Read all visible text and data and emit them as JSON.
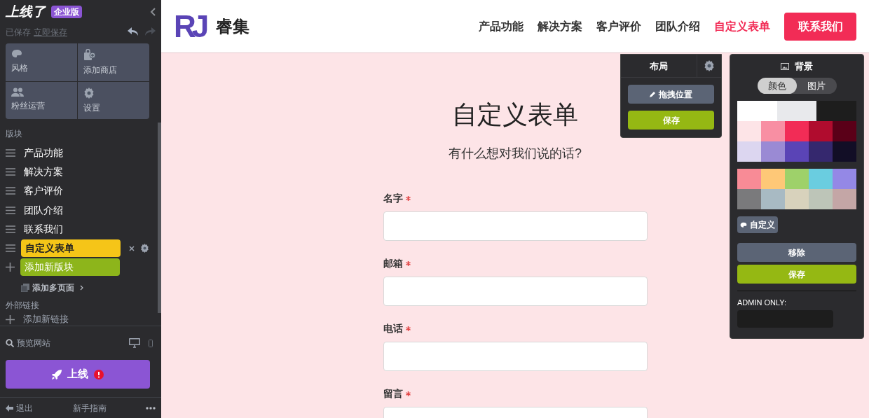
{
  "sidebar": {
    "brand": "上线了",
    "edition": "企业版",
    "save_status": "已保存",
    "save_link": "立即保存",
    "tools": [
      {
        "kind": "palette",
        "label": "风格"
      },
      {
        "kind": "shop",
        "label": "添加商店"
      },
      {
        "kind": "users",
        "label": "粉丝运营"
      },
      {
        "kind": "gear",
        "label": "设置"
      }
    ],
    "sections_title": "版块",
    "sections": [
      {
        "label": "产品功能",
        "selected": false
      },
      {
        "label": "解决方案",
        "selected": false
      },
      {
        "label": "客户评价",
        "selected": false
      },
      {
        "label": "团队介绍",
        "selected": false
      },
      {
        "label": "联系我们",
        "selected": false
      },
      {
        "label": "自定义表单",
        "selected": true
      }
    ],
    "add_section": "添加新版块",
    "add_page": "添加多页面",
    "links_title": "外部链接",
    "add_link": "添加新链接",
    "preview": "预览网站",
    "publish": "上线",
    "logout": "退出",
    "guide": "新手指南"
  },
  "header": {
    "logo": "RJ",
    "name": "睿集",
    "nav": [
      {
        "label": "产品功能",
        "selected": false
      },
      {
        "label": "解决方案",
        "selected": false
      },
      {
        "label": "客户评价",
        "selected": false
      },
      {
        "label": "团队介绍",
        "selected": false
      },
      {
        "label": "自定义表单",
        "selected": true
      }
    ],
    "cta": "联系我们"
  },
  "form": {
    "title": "自定义表单",
    "subtitle": "有什么想对我们说的话?",
    "fields": [
      {
        "label": "名字",
        "required": true
      },
      {
        "label": "邮箱",
        "required": true
      },
      {
        "label": "电话",
        "required": true
      },
      {
        "label": "留言",
        "required": true
      }
    ]
  },
  "layout_panel": {
    "title": "布局",
    "drag": "拖拽位置",
    "save": "保存"
  },
  "background_panel": {
    "title": "背景",
    "tabs": [
      {
        "label": "颜色",
        "selected": true
      },
      {
        "label": "图片",
        "selected": false
      }
    ],
    "palettes": [
      {
        "rows": [
          [
            {
              "color": "#ffffff"
            },
            {
              "color": "#e8e9ec"
            },
            {
              "color": "#1d1d1d"
            }
          ],
          [
            {
              "color": "#fde4e7"
            },
            {
              "color": "#f88fa3"
            },
            {
              "color": "#f22c56"
            },
            {
              "color": "#b00c2e"
            },
            {
              "color": "#5a0018"
            }
          ],
          [
            {
              "color": "#dcd6f0"
            },
            {
              "color": "#9a8ad4"
            },
            {
              "color": "#5a44b6"
            },
            {
              "color": "#35286e"
            },
            {
              "color": "#120e26"
            }
          ]
        ]
      },
      {
        "rows": [
          [
            {
              "color": "#f88b96"
            },
            {
              "color": "#fec877"
            },
            {
              "color": "#9ed16a"
            },
            {
              "color": "#6acde0"
            },
            {
              "color": "#9488e6"
            }
          ],
          [
            {
              "color": "#7a7a7c"
            },
            {
              "color": "#a8bac3"
            },
            {
              "color": "#d8d2bc"
            },
            {
              "color": "#bdc5b8"
            },
            {
              "color": "#c4a6a6"
            }
          ]
        ]
      }
    ],
    "custom": "自定义",
    "remove": "移除",
    "save": "保存",
    "admin_label": "ADMIN ONLY:"
  }
}
